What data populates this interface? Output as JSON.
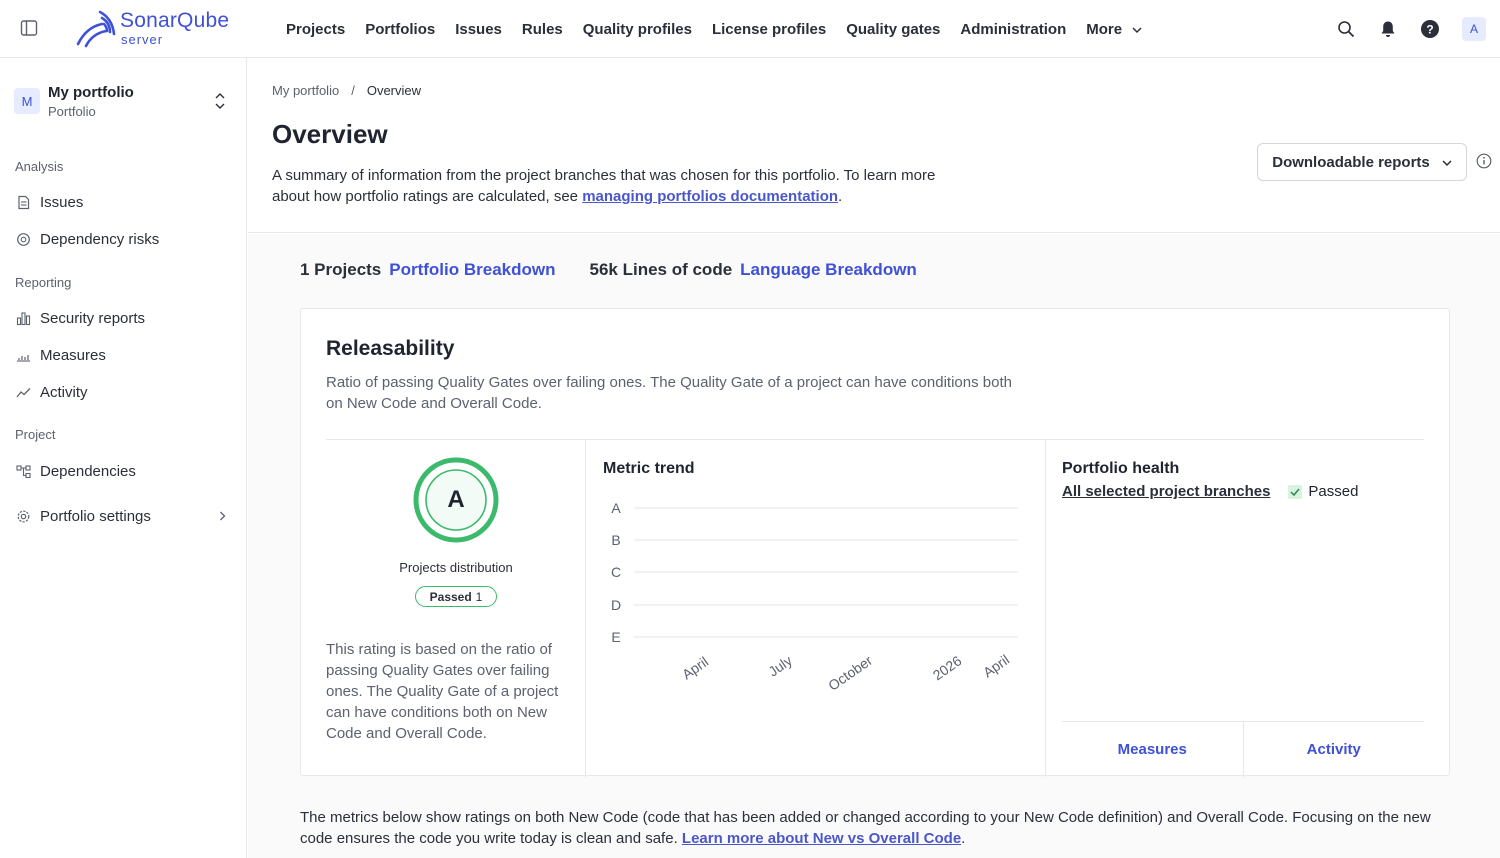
{
  "app": {
    "logo_name": "SonarQube",
    "logo_sub": "server",
    "brand_color": "#3f51d6"
  },
  "nav": {
    "items": [
      "Projects",
      "Portfolios",
      "Issues",
      "Rules",
      "Quality profiles",
      "License profiles",
      "Quality gates",
      "Administration"
    ],
    "more_label": "More",
    "icons": [
      "search-icon",
      "bell-icon",
      "help-icon"
    ],
    "avatar_letter": "A"
  },
  "sidebar": {
    "portfolio_initial": "M",
    "portfolio_name": "My portfolio",
    "portfolio_type": "Portfolio",
    "sections": {
      "analysis": "Analysis",
      "reporting": "Reporting",
      "project": "Project"
    },
    "items": {
      "issues": "Issues",
      "dependency_risks": "Dependency risks",
      "security_reports": "Security reports",
      "measures": "Measures",
      "activity": "Activity",
      "dependencies": "Dependencies",
      "portfolio_settings": "Portfolio settings"
    }
  },
  "header": {
    "breadcrumb": [
      "My portfolio",
      "/",
      "Overview"
    ],
    "title": "Overview",
    "desc_before": "A summary of information from the project branches that was chosen for this portfolio. To learn more about how portfolio ratings are calculated, see ",
    "desc_link": "managing portfolios documentation",
    "desc_after": ".",
    "download_label": "Downloadable reports"
  },
  "summary": {
    "projects_label": "1 Projects",
    "projects_link": "Portfolio Breakdown",
    "loc_label": "56k Lines of code",
    "loc_link": "Language Breakdown"
  },
  "releasability": {
    "title": "Releasability",
    "desc": "Ratio of passing Quality Gates over failing ones. The Quality Gate of a project can have conditions both on New Code and Overall Code.",
    "rating": "A",
    "rating_color": "#3cba6b",
    "dist_label": "Projects distribution",
    "passed_label": "Passed",
    "passed_count": "1",
    "note": "This rating is based on the ratio of passing Quality Gates over failing ones. The Quality Gate of a project can have conditions both on New Code and Overall Code.",
    "trend_title": "Metric trend",
    "trend_y": [
      "A",
      "B",
      "C",
      "D",
      "E"
    ],
    "trend_x": [
      "April",
      "July",
      "October",
      "2026",
      "April"
    ],
    "health_title": "Portfolio health",
    "health_link": "All selected project branches",
    "health_status": "Passed",
    "footer_measures": "Measures",
    "footer_activity": "Activity"
  },
  "bottom": {
    "text": "The metrics below show ratings on both New Code (code that has been added or changed according to your New Code definition) and Overall Code. Focusing on the new code ensures the code you write today is clean and safe. ",
    "link": "Learn more about New vs Overall Code",
    "after": "."
  }
}
